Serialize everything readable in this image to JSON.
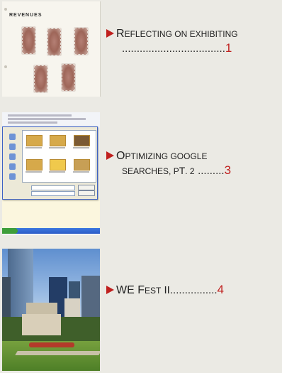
{
  "thumbnails": {
    "album": {
      "title": "REVENUES",
      "subtitle": ""
    },
    "screenshot": {
      "description_hidden": ""
    }
  },
  "toc": [
    {
      "arrow_icon": "red-triangle-arrow-icon",
      "big1": "R",
      "small1": "EFLECTING ON EXHIBITING",
      "dots": "...................................",
      "page": "1"
    },
    {
      "arrow_icon": "red-triangle-arrow-icon",
      "big1": "O",
      "small1": "PTIMIZING GOOGLE",
      "line2_small": "SEARCHES",
      "line2_mid": ", P",
      "line2_big_t": "T",
      "line2_rest": ". 2",
      "dots": ".........",
      "page": "3"
    },
    {
      "arrow_icon": "red-triangle-arrow-icon",
      "big1": "WE F",
      "small1": "EST",
      "roman": " II",
      "dots": "................",
      "page": "4"
    }
  ],
  "colors": {
    "accent": "#c0201e",
    "text": "#222222",
    "background": "#ebeae4"
  }
}
